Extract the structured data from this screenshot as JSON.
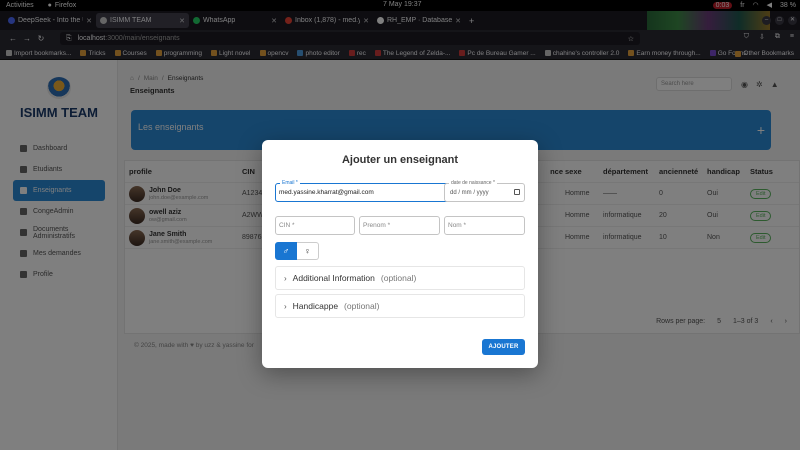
{
  "system_bar": {
    "activities": "Activities",
    "app": "Firefox",
    "clock": "7 May  19:37",
    "rec": "0:03",
    "lang": "fr",
    "battery": "38 %"
  },
  "tabs": [
    {
      "label": "DeepSeek - Into the Unkn",
      "color": "#4d6bfe"
    },
    {
      "label": "ISIMM TEAM",
      "color": "#cccccc"
    },
    {
      "label": "WhatsApp",
      "color": "#25d366"
    },
    {
      "label": "Inbox (1,878) - med.yassin",
      "color": "#ea4335"
    },
    {
      "label": "RH_EMP · Database · ",
      "color": "#ffffff"
    }
  ],
  "url": {
    "host": "localhost",
    "path": ":3000/main/enseignants"
  },
  "bookmarks": [
    {
      "label": "Import bookmarks...",
      "color": "#cccccc"
    },
    {
      "label": "Tricks",
      "color": "#e6a23c"
    },
    {
      "label": "Courses",
      "color": "#e6a23c"
    },
    {
      "label": "programming",
      "color": "#e6a23c"
    },
    {
      "label": "Light novel",
      "color": "#e6a23c"
    },
    {
      "label": "opencv",
      "color": "#e6a23c"
    },
    {
      "label": "photo editor",
      "color": "#4d9de0"
    },
    {
      "label": "rec",
      "color": "#d03b3b"
    },
    {
      "label": "The Legend of Zelda-...",
      "color": "#d03b3b"
    },
    {
      "label": "Pc de Bureau Gamer ...",
      "color": "#d03b3b"
    },
    {
      "label": "chahine's controller 2.0",
      "color": "#cccccc"
    },
    {
      "label": "Earn money through...",
      "color": "#e6a23c"
    },
    {
      "label": "Go Forms",
      "color": "#7a4ad0"
    }
  ],
  "other_bookmarks": "Other Bookmarks",
  "sidebar": {
    "brand": "ISIMM TEAM",
    "items": [
      {
        "label": "Dashboard",
        "active": false
      },
      {
        "label": "Etudiants",
        "active": false
      },
      {
        "label": "Enseignants",
        "active": true
      },
      {
        "label": "CongeAdmin",
        "active": false
      },
      {
        "label": "Documents Administratifs",
        "active": false
      },
      {
        "label": "Mes demandes",
        "active": false
      },
      {
        "label": "Profile",
        "active": false
      }
    ]
  },
  "header": {
    "crumb_home": "⌂",
    "crumb_main": "Main",
    "crumb_current": "Enseignants",
    "title": "Enseignants",
    "search_placeholder": "Search here"
  },
  "banner": {
    "title": "Les enseignants",
    "plus": "+"
  },
  "table": {
    "columns": [
      "profile",
      "CIN",
      "nce",
      "sexe",
      "département",
      "ancienneté",
      "handicap",
      "Status"
    ],
    "rows": [
      {
        "name": "John Doe",
        "email": "john.doe@example.com",
        "cin": "A12345",
        "sexe": "Homme",
        "dep": "——",
        "anc": "0",
        "hand": "Oui",
        "action": "Edit"
      },
      {
        "name": "owell aziz",
        "email": "ow@gmail.com",
        "cin": "A2WW",
        "sexe": "Homme",
        "dep": "informatique",
        "anc": "20",
        "hand": "Oui",
        "action": "Edit"
      },
      {
        "name": "Jane Smith",
        "email": "jane.smith@example.com",
        "cin": "89876",
        "sexe": "Homme",
        "dep": "informatique",
        "anc": "10",
        "hand": "Non",
        "action": "Edit"
      }
    ],
    "rows_per_page_label": "Rows per page:",
    "rows_per_page": "5",
    "range": "1–3 of 3"
  },
  "footer": "© 2025, made with ♥ by uzz & yassine for",
  "modal": {
    "title": "Ajouter un enseignant",
    "email_label": "Email *",
    "email_value": "med.yassine.kharrat@gmail.com",
    "date_label": "date de naissance *",
    "date_value": "dd / mm / yyyy",
    "cin_placeholder": "CIN *",
    "prenom_placeholder": "Prenom *",
    "nom_placeholder": "Nom *",
    "male_icon": "♂",
    "female_icon": "♀",
    "accordion1_title": "Additional Information",
    "accordion1_opt": "(optional)",
    "accordion2_title": "Handicappe",
    "accordion2_opt": "(optional)",
    "submit": "AJOUTER",
    "accent": "#1976d2"
  }
}
